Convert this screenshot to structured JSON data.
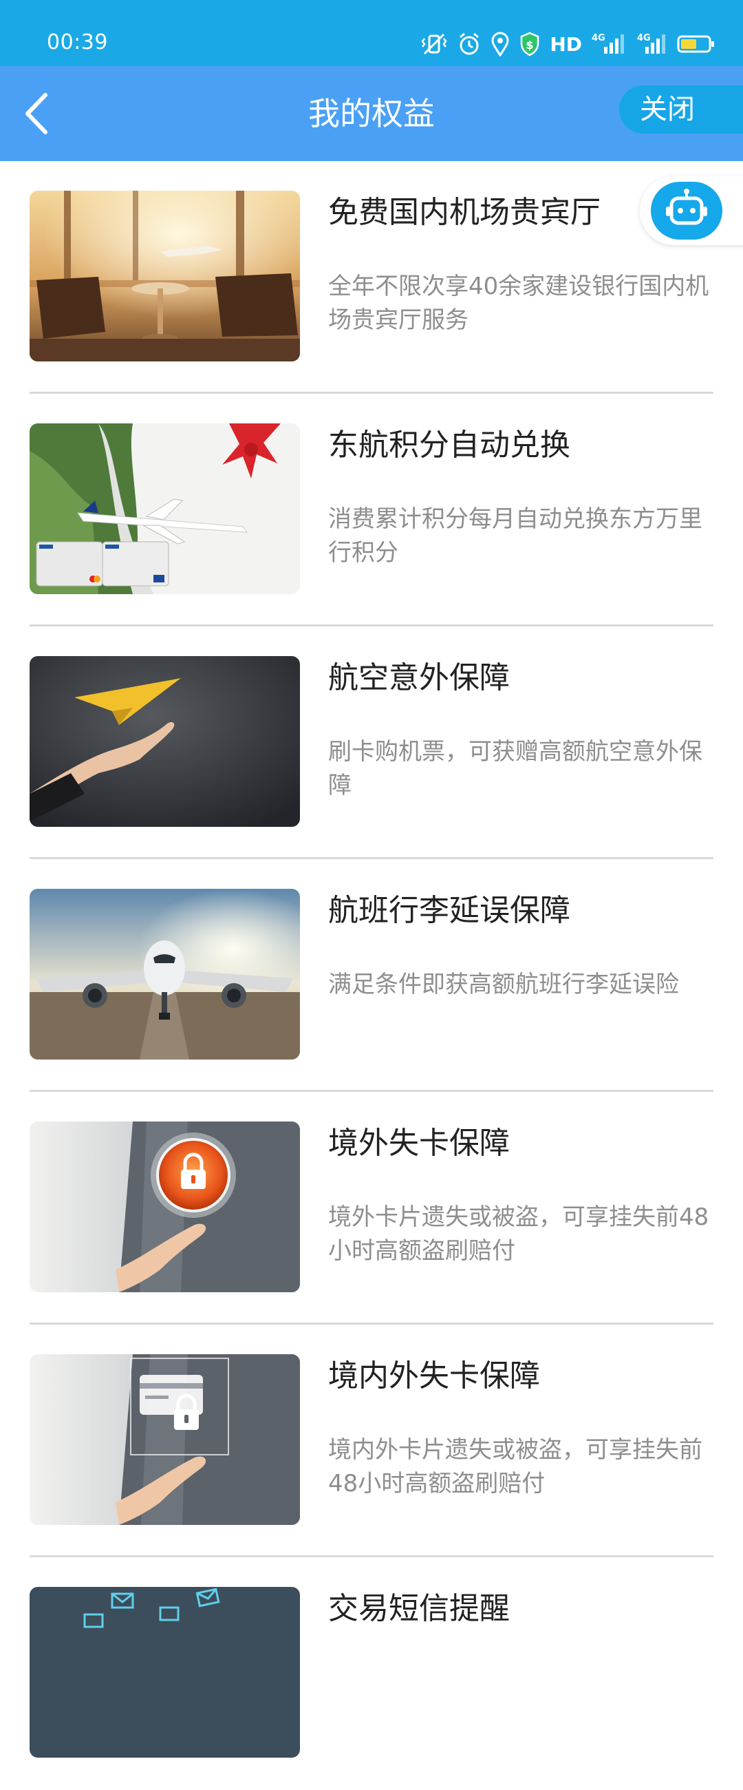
{
  "status_bar": {
    "time": "00:39",
    "hd_label": "HD",
    "network_1": "4G",
    "network_2": "4G",
    "icons": [
      "vibrate-icon",
      "alarm-icon",
      "location-icon",
      "shield-icon",
      "signal-icon",
      "battery-icon"
    ],
    "color": "#1aa9e6"
  },
  "nav": {
    "title": "我的权益",
    "close_label": "关闭",
    "back_icon": "chevron-left-icon",
    "color": "#4aa0f5"
  },
  "robot": {
    "icon": "robot-icon"
  },
  "items": [
    {
      "title": "免费国内机场贵宾厅",
      "desc": "全年不限次享40余家建设银行国内机场贵宾厅服务",
      "image": "airport-lounge"
    },
    {
      "title": "东航积分自动兑换",
      "desc": "消费累计积分每月自动兑换东方万里行积分",
      "image": "china-eastern-cards"
    },
    {
      "title": "航空意外保障",
      "desc": "刷卡购机票，可获赠高额航空意外保障",
      "image": "paper-plane-hand"
    },
    {
      "title": "航班行李延误保障",
      "desc": "满足条件即获高额航班行李延误险",
      "image": "airplane-runway"
    },
    {
      "title": "境外失卡保障",
      "desc": "境外卡片遗失或被盗，可享挂失前48小时高额盗刷赔付",
      "image": "lock-hand"
    },
    {
      "title": "境内外失卡保障",
      "desc": "境内外卡片遗失或被盗，可享挂失前48小时高额盗刷赔付",
      "image": "card-lock-hand"
    },
    {
      "title": "交易短信提醒",
      "desc": "",
      "image": "sms-envelopes"
    }
  ]
}
